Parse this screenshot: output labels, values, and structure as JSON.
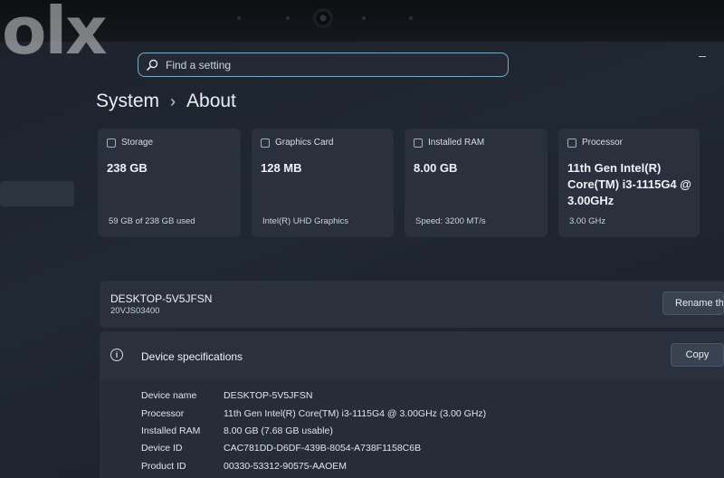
{
  "watermark": "olx",
  "search": {
    "placeholder": "Find a setting"
  },
  "breadcrumb": {
    "section": "System",
    "separator": "›",
    "page": "About"
  },
  "cards": [
    {
      "label": "Storage",
      "value": "238 GB",
      "sub": "59 GB of 238 GB used",
      "icon": "storage-icon"
    },
    {
      "label": "Graphics Card",
      "value": "128 MB",
      "sub": "Intel(R) UHD Graphics",
      "icon": "graphics-card-icon"
    },
    {
      "label": "Installed RAM",
      "value": "8.00 GB",
      "sub": "Speed: 3200 MT/s",
      "icon": "ram-icon"
    },
    {
      "label": "Processor",
      "value": "11th Gen Intel(R) Core(TM) i3-1115G4 @ 3.00GHz",
      "sub": "3.00 GHz",
      "icon": "processor-icon"
    }
  ],
  "device": {
    "name": "DESKTOP-5V5JFSN",
    "model": "20VJS03400",
    "rename_label": "Rename thi"
  },
  "specs": {
    "title": "Device specifications",
    "copy_label": "Copy",
    "rows": [
      {
        "label": "Device name",
        "value": "DESKTOP-5V5JFSN"
      },
      {
        "label": "Processor",
        "value": "11th Gen Intel(R) Core(TM) i3-1115G4 @ 3.00GHz (3.00 GHz)"
      },
      {
        "label": "Installed RAM",
        "value": "8.00 GB (7.68 GB usable)"
      },
      {
        "label": "Device ID",
        "value": "CAC781DD-D6DF-439B-8054-A738F1158C6B"
      },
      {
        "label": "Product ID",
        "value": "00330-53312-90575-AAOEM"
      }
    ]
  }
}
